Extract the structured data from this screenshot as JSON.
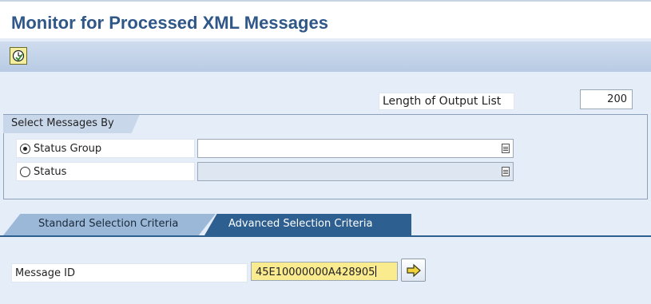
{
  "page": {
    "title": "Monitor for Processed XML Messages"
  },
  "toolbar": {
    "execute_icon": "execute-clock-icon"
  },
  "output": {
    "label": "Length of Output List",
    "value": "200"
  },
  "selection": {
    "group_title": "Select Messages By",
    "options": [
      {
        "label": "Status Group",
        "selected": true,
        "field_value": ""
      },
      {
        "label": "Status",
        "selected": false,
        "field_value": ""
      }
    ]
  },
  "tabs": [
    {
      "label": "Standard Selection Criteria",
      "active": false
    },
    {
      "label": "Advanced Selection Criteria",
      "active": true
    }
  ],
  "message_id": {
    "label": "Message ID",
    "value": "45E10000000A428905"
  },
  "colors": {
    "title": "#2f5788",
    "active_tab": "#2e5f91",
    "input_highlight": "#fbeb8f"
  }
}
